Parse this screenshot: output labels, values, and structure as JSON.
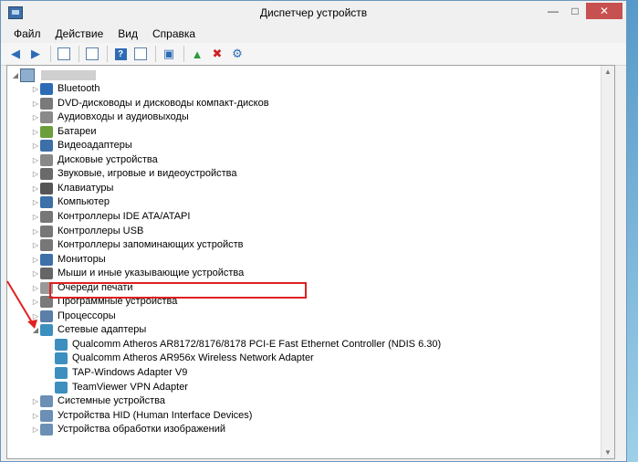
{
  "window": {
    "title": "Диспетчер устройств"
  },
  "menu": [
    "Файл",
    "Действие",
    "Вид",
    "Справка"
  ],
  "tree": {
    "categories": [
      {
        "label": "Bluetooth",
        "icon": "bluetooth-icon"
      },
      {
        "label": "DVD-дисководы и дисководы компакт-дисков",
        "icon": "dvd-drive-icon"
      },
      {
        "label": "Аудиовходы и аудиовыходы",
        "icon": "audio-icon"
      },
      {
        "label": "Батареи",
        "icon": "battery-icon"
      },
      {
        "label": "Видеоадаптеры",
        "icon": "display-adapter-icon"
      },
      {
        "label": "Дисковые устройства",
        "icon": "disk-drive-icon"
      },
      {
        "label": "Звуковые, игровые и видеоустройства",
        "icon": "sound-icon"
      },
      {
        "label": "Клавиатуры",
        "icon": "keyboard-icon"
      },
      {
        "label": "Компьютер",
        "icon": "computer-icon"
      },
      {
        "label": "Контроллеры IDE ATA/ATAPI",
        "icon": "ide-controller-icon"
      },
      {
        "label": "Контроллеры USB",
        "icon": "usb-controller-icon"
      },
      {
        "label": "Контроллеры запоминающих устройств",
        "icon": "storage-controller-icon"
      },
      {
        "label": "Мониторы",
        "icon": "monitor-icon"
      },
      {
        "label": "Мыши и иные указывающие устройства",
        "icon": "mouse-icon"
      },
      {
        "label": "Очереди печати",
        "icon": "print-queue-icon"
      },
      {
        "label": "Программные устройства",
        "icon": "software-device-icon"
      },
      {
        "label": "Процессоры",
        "icon": "processor-icon"
      },
      {
        "label": "Сетевые адаптеры",
        "icon": "network-adapter-icon"
      }
    ],
    "network_children": [
      "Qualcomm Atheros AR8172/8176/8178 PCI-E Fast Ethernet Controller (NDIS 6.30)",
      "Qualcomm Atheros AR956x Wireless Network Adapter",
      "TAP-Windows Adapter V9",
      "TeamViewer VPN Adapter"
    ],
    "after": [
      {
        "label": "Системные устройства",
        "icon": "system-device-icon"
      },
      {
        "label": "Устройства HID (Human Interface Devices)",
        "icon": "hid-icon"
      },
      {
        "label": "Устройства обработки изображений",
        "icon": "imaging-device-icon"
      }
    ]
  },
  "colors": {
    "highlight": "#e02020",
    "accent": "#2d6bb5"
  }
}
